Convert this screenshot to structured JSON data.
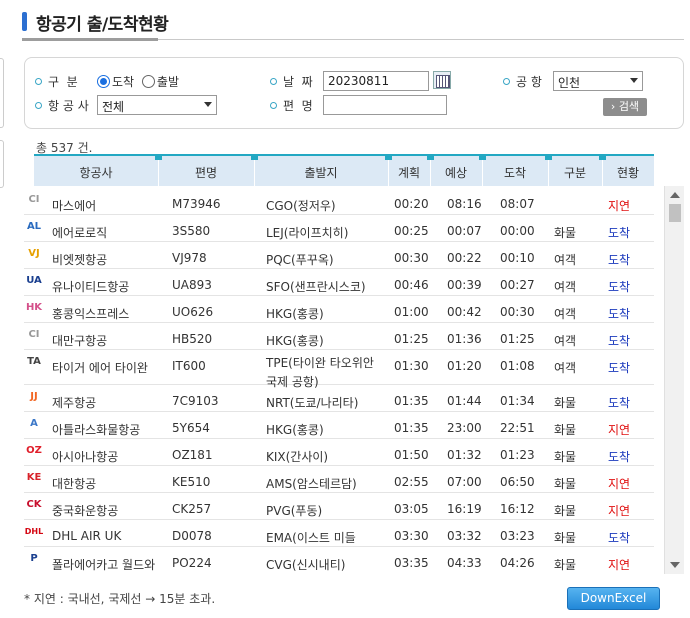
{
  "page": {
    "title": "항공기 출/도착현황"
  },
  "search": {
    "type_label": "구  분",
    "radio_arrival": "도착",
    "radio_departure": "출발",
    "date_label": "날  짜",
    "date_value": "20230811",
    "airport_label": "공 항",
    "airport_value": "인천",
    "airline_label": "항 공 사",
    "airline_value": "전체",
    "flight_label": "편  명",
    "flight_value": "",
    "search_button": "› 검색"
  },
  "total": "총 537 건.",
  "table": {
    "headers": [
      "항공사",
      "편명",
      "출발지",
      "계획",
      "예상",
      "도착",
      "구분",
      "현황"
    ],
    "rows": [
      {
        "logo": "CI",
        "logo_color": "#999999",
        "airline": "마스에어",
        "flight": "M73946",
        "origin": "CGO(정저우)",
        "origin2": "",
        "planned": "00:20",
        "expected": "08:16",
        "arrived": "08:07",
        "type": "",
        "status": "지연",
        "status_kind": "delay"
      },
      {
        "logo": "AL",
        "logo_color": "#2a6bbf",
        "airline": "에어로로직",
        "flight": "3S580",
        "origin": "LEJ(라이프치히)",
        "origin2": "",
        "planned": "00:25",
        "expected": "00:07",
        "arrived": "00:00",
        "type": "화물",
        "status": "도착",
        "status_kind": "arrived"
      },
      {
        "logo": "VJ",
        "logo_color": "#e6a000",
        "airline": "비엣젯항공",
        "flight": "VJ978",
        "origin": "PQC(푸꾸옥)",
        "origin2": "",
        "planned": "00:30",
        "expected": "00:22",
        "arrived": "00:10",
        "type": "여객",
        "status": "도착",
        "status_kind": "arrived"
      },
      {
        "logo": "UA",
        "logo_color": "#1a3f8f",
        "airline": "유나이티드항공",
        "flight": "UA893",
        "origin": "SFO(샌프란시스코)",
        "origin2": "",
        "planned": "00:46",
        "expected": "00:39",
        "arrived": "00:27",
        "type": "여객",
        "status": "도착",
        "status_kind": "arrived"
      },
      {
        "logo": "HK",
        "logo_color": "#d4508a",
        "airline": "홍콩익스프레스",
        "flight": "UO626",
        "origin": "HKG(홍콩)",
        "origin2": "",
        "planned": "01:00",
        "expected": "00:42",
        "arrived": "00:30",
        "type": "여객",
        "status": "도착",
        "status_kind": "arrived"
      },
      {
        "logo": "CI",
        "logo_color": "#999999",
        "airline": "대만구항공",
        "flight": "HB520",
        "origin": "HKG(홍콩)",
        "origin2": "",
        "planned": "01:25",
        "expected": "01:36",
        "arrived": "01:25",
        "type": "여객",
        "status": "도착",
        "status_kind": "arrived"
      },
      {
        "logo": "TA",
        "logo_color": "#444444",
        "airline": "타이거 에어 타이완",
        "flight": "IT600",
        "origin": "TPE(타이완 타오위안",
        "origin2": "국제 공항)",
        "planned": "01:30",
        "expected": "01:20",
        "arrived": "01:08",
        "type": "여객",
        "status": "도착",
        "status_kind": "arrived"
      },
      {
        "logo": "JJ",
        "logo_color": "#f26522",
        "airline": "제주항공",
        "flight": "7C9103",
        "origin": "NRT(도쿄/나리타)",
        "origin2": "",
        "planned": "01:35",
        "expected": "01:44",
        "arrived": "01:34",
        "type": "화물",
        "status": "도착",
        "status_kind": "arrived"
      },
      {
        "logo": "A",
        "logo_color": "#3c78c8",
        "airline": "아틀라스화물항공",
        "flight": "5Y654",
        "origin": "HKG(홍콩)",
        "origin2": "",
        "planned": "01:35",
        "expected": "23:00",
        "arrived": "22:51",
        "type": "화물",
        "status": "지연",
        "status_kind": "delay"
      },
      {
        "logo": "OZ",
        "logo_color": "#e01e2a",
        "airline": "아시아나항공",
        "flight": "OZ181",
        "origin": "KIX(간사이)",
        "origin2": "",
        "planned": "01:50",
        "expected": "01:32",
        "arrived": "01:23",
        "type": "화물",
        "status": "도착",
        "status_kind": "arrived"
      },
      {
        "logo": "KE",
        "logo_color": "#d8232a",
        "airline": "대한항공",
        "flight": "KE510",
        "origin": "AMS(암스테르담)",
        "origin2": "",
        "planned": "02:55",
        "expected": "07:00",
        "arrived": "06:50",
        "type": "화물",
        "status": "지연",
        "status_kind": "delay"
      },
      {
        "logo": "CK",
        "logo_color": "#c8102e",
        "airline": "중국화운항공",
        "flight": "CK257",
        "origin": "PVG(푸동)",
        "origin2": "",
        "planned": "03:05",
        "expected": "16:19",
        "arrived": "16:12",
        "type": "화물",
        "status": "지연",
        "status_kind": "delay"
      },
      {
        "logo": "DHL",
        "logo_color": "#d40511",
        "airline": "DHL AIR UK",
        "flight": "D0078",
        "origin": "EMA(이스트 미들",
        "origin2": "",
        "planned": "03:30",
        "expected": "03:32",
        "arrived": "03:23",
        "type": "화물",
        "status": "도착",
        "status_kind": "arrived"
      },
      {
        "logo": "P",
        "logo_color": "#1a3f8f",
        "airline": "폴라에어카고 월드와",
        "flight": "PO224",
        "origin": "CVG(신시내티)",
        "origin2": "",
        "planned": "03:35",
        "expected": "04:33",
        "arrived": "04:26",
        "type": "화물",
        "status": "지연",
        "status_kind": "delay"
      }
    ]
  },
  "footnote": "* 지연 : 국내선, 국제선 → 15분 초과.",
  "excel_button": "DownExcel",
  "colors": {
    "accent": "#23a8c3",
    "delay": "#e01010",
    "arrived": "#1d3bbd",
    "title_bar": "#2c6fd1"
  }
}
